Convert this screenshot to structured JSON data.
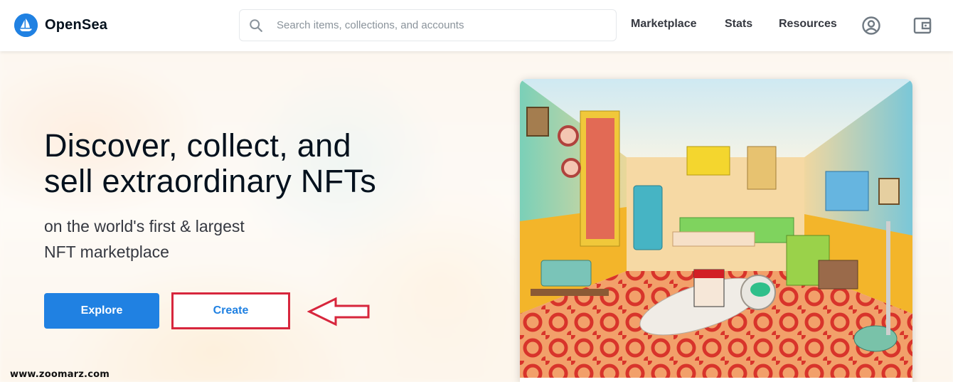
{
  "navbar": {
    "brand": "OpenSea",
    "search": {
      "placeholder": "Search items, collections, and accounts",
      "value": ""
    },
    "links": [
      {
        "label": "Marketplace"
      },
      {
        "label": "Stats"
      },
      {
        "label": "Resources"
      }
    ],
    "icons": [
      "account-icon",
      "wallet-icon"
    ]
  },
  "hero": {
    "title_line1": "Discover, collect, and",
    "title_line2": "sell extraordinary NFTs",
    "subtitle_line1": "on the world's first & largest",
    "subtitle_line2": "NFT marketplace",
    "explore_label": "Explore",
    "create_label": "Create"
  },
  "annotation": {
    "arrow_color": "#d7263d",
    "highlight_color": "#d7263d"
  },
  "featured": {
    "image": "retro-room-astronaut-artwork"
  },
  "watermark": "www.zoomarz.com",
  "colors": {
    "accent": "#2081e2",
    "text": "#04111d"
  }
}
